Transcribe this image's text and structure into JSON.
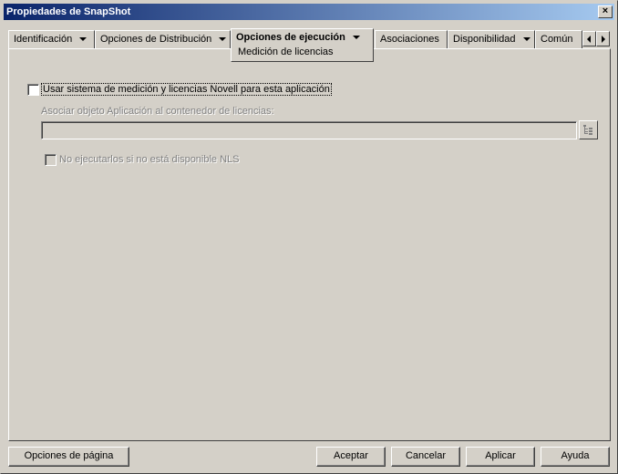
{
  "window": {
    "title": "Propiedades de SnapShot",
    "close_glyph": "×"
  },
  "tabs": [
    {
      "label": "Identificación",
      "has_dropdown": true
    },
    {
      "label": "Opciones de Distribución",
      "has_dropdown": true
    },
    {
      "label": "Opciones de ejecución",
      "has_dropdown": true,
      "active": true
    },
    {
      "label": "Asociaciones",
      "has_dropdown": false
    },
    {
      "label": "Disponibilidad",
      "has_dropdown": true
    },
    {
      "label": "Común",
      "has_dropdown": false
    }
  ],
  "active_subtab": "Medición de licencias",
  "panel": {
    "use_metering_checkbox": {
      "label": "Usar sistema de medición y licencias Novell para esta aplicación",
      "checked": false
    },
    "associate_label": "Asociar objeto Aplicación al contenedor de licencias:",
    "associate_value": "",
    "no_run_checkbox": {
      "label": "No ejecutarlos si no está disponible NLS",
      "checked": false,
      "enabled": false
    }
  },
  "footer": {
    "page_options": "Opciones de página",
    "accept": "Aceptar",
    "cancel": "Cancelar",
    "apply": "Aplicar",
    "help": "Ayuda"
  },
  "icons": {
    "browse": "browse-tree-icon",
    "scroll_left": "tab-scroll-left-icon",
    "scroll_right": "tab-scroll-right-icon",
    "dropdown": "chevron-down-icon"
  }
}
